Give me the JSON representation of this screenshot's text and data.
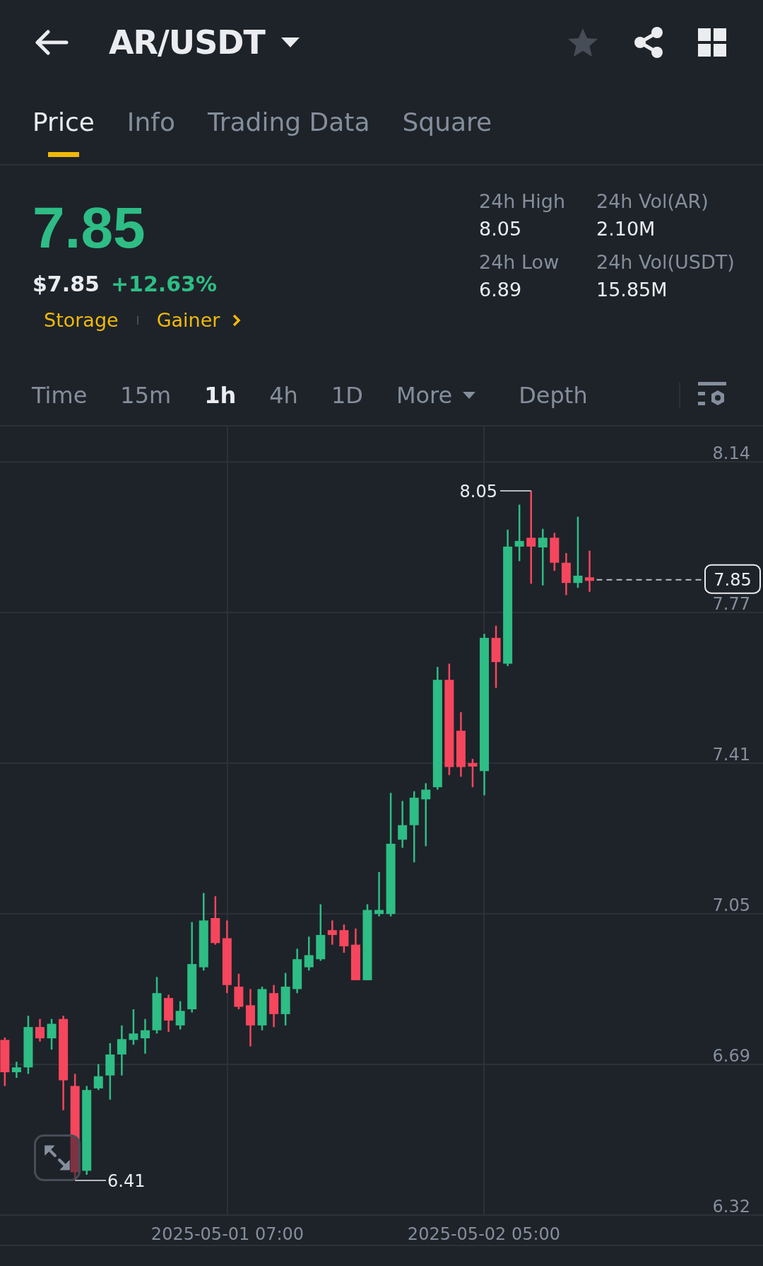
{
  "header": {
    "title": "AR/USDT",
    "favorite": false
  },
  "tabs": [
    {
      "label": "Price",
      "selected": true
    },
    {
      "label": "Info",
      "selected": false
    },
    {
      "label": "Trading Data",
      "selected": false
    },
    {
      "label": "Square",
      "selected": false
    }
  ],
  "ticker": {
    "last_price": "7.85",
    "usd_price": "$7.85",
    "change": "+12.63%",
    "tags": [
      "Storage",
      "Gainer"
    ]
  },
  "stats": [
    {
      "label": "24h High",
      "value": "8.05"
    },
    {
      "label": "24h Vol(AR)",
      "value": "2.10M"
    },
    {
      "label": "24h Low",
      "value": "6.89"
    },
    {
      "label": "24h Vol(USDT)",
      "value": "15.85M"
    }
  ],
  "intervals": [
    {
      "label": "Time",
      "kind": "option",
      "selected": false
    },
    {
      "label": "15m",
      "kind": "option",
      "selected": false
    },
    {
      "label": "1h",
      "kind": "option",
      "selected": true
    },
    {
      "label": "4h",
      "kind": "option",
      "selected": false
    },
    {
      "label": "1D",
      "kind": "option",
      "selected": false
    },
    {
      "label": "More",
      "kind": "dropdown",
      "selected": false
    },
    {
      "label": "Depth",
      "kind": "option",
      "selected": false
    }
  ],
  "chart": {
    "y_axis_labels": [
      "8.14",
      "7.77",
      "7.41",
      "7.05",
      "6.69",
      "6.32"
    ],
    "x_axis_labels": [
      "2025-05-01 07:00",
      "2025-05-02 05:00"
    ],
    "high_marker": "8.05",
    "low_marker": "6.41",
    "last_price_tag": "7.85"
  }
}
